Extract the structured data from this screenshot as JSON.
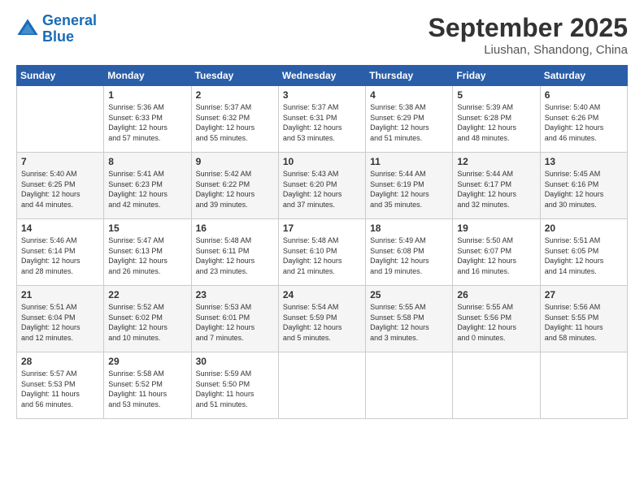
{
  "header": {
    "logo_line1": "General",
    "logo_line2": "Blue",
    "month": "September 2025",
    "location": "Liushan, Shandong, China"
  },
  "days": [
    "Sunday",
    "Monday",
    "Tuesday",
    "Wednesday",
    "Thursday",
    "Friday",
    "Saturday"
  ],
  "weeks": [
    [
      {
        "date": "",
        "sunrise": "",
        "sunset": "",
        "daylight": ""
      },
      {
        "date": "1",
        "sunrise": "Sunrise: 5:36 AM",
        "sunset": "Sunset: 6:33 PM",
        "daylight": "Daylight: 12 hours and 57 minutes."
      },
      {
        "date": "2",
        "sunrise": "Sunrise: 5:37 AM",
        "sunset": "Sunset: 6:32 PM",
        "daylight": "Daylight: 12 hours and 55 minutes."
      },
      {
        "date": "3",
        "sunrise": "Sunrise: 5:37 AM",
        "sunset": "Sunset: 6:31 PM",
        "daylight": "Daylight: 12 hours and 53 minutes."
      },
      {
        "date": "4",
        "sunrise": "Sunrise: 5:38 AM",
        "sunset": "Sunset: 6:29 PM",
        "daylight": "Daylight: 12 hours and 51 minutes."
      },
      {
        "date": "5",
        "sunrise": "Sunrise: 5:39 AM",
        "sunset": "Sunset: 6:28 PM",
        "daylight": "Daylight: 12 hours and 48 minutes."
      },
      {
        "date": "6",
        "sunrise": "Sunrise: 5:40 AM",
        "sunset": "Sunset: 6:26 PM",
        "daylight": "Daylight: 12 hours and 46 minutes."
      }
    ],
    [
      {
        "date": "7",
        "sunrise": "Sunrise: 5:40 AM",
        "sunset": "Sunset: 6:25 PM",
        "daylight": "Daylight: 12 hours and 44 minutes."
      },
      {
        "date": "8",
        "sunrise": "Sunrise: 5:41 AM",
        "sunset": "Sunset: 6:23 PM",
        "daylight": "Daylight: 12 hours and 42 minutes."
      },
      {
        "date": "9",
        "sunrise": "Sunrise: 5:42 AM",
        "sunset": "Sunset: 6:22 PM",
        "daylight": "Daylight: 12 hours and 39 minutes."
      },
      {
        "date": "10",
        "sunrise": "Sunrise: 5:43 AM",
        "sunset": "Sunset: 6:20 PM",
        "daylight": "Daylight: 12 hours and 37 minutes."
      },
      {
        "date": "11",
        "sunrise": "Sunrise: 5:44 AM",
        "sunset": "Sunset: 6:19 PM",
        "daylight": "Daylight: 12 hours and 35 minutes."
      },
      {
        "date": "12",
        "sunrise": "Sunrise: 5:44 AM",
        "sunset": "Sunset: 6:17 PM",
        "daylight": "Daylight: 12 hours and 32 minutes."
      },
      {
        "date": "13",
        "sunrise": "Sunrise: 5:45 AM",
        "sunset": "Sunset: 6:16 PM",
        "daylight": "Daylight: 12 hours and 30 minutes."
      }
    ],
    [
      {
        "date": "14",
        "sunrise": "Sunrise: 5:46 AM",
        "sunset": "Sunset: 6:14 PM",
        "daylight": "Daylight: 12 hours and 28 minutes."
      },
      {
        "date": "15",
        "sunrise": "Sunrise: 5:47 AM",
        "sunset": "Sunset: 6:13 PM",
        "daylight": "Daylight: 12 hours and 26 minutes."
      },
      {
        "date": "16",
        "sunrise": "Sunrise: 5:48 AM",
        "sunset": "Sunset: 6:11 PM",
        "daylight": "Daylight: 12 hours and 23 minutes."
      },
      {
        "date": "17",
        "sunrise": "Sunrise: 5:48 AM",
        "sunset": "Sunset: 6:10 PM",
        "daylight": "Daylight: 12 hours and 21 minutes."
      },
      {
        "date": "18",
        "sunrise": "Sunrise: 5:49 AM",
        "sunset": "Sunset: 6:08 PM",
        "daylight": "Daylight: 12 hours and 19 minutes."
      },
      {
        "date": "19",
        "sunrise": "Sunrise: 5:50 AM",
        "sunset": "Sunset: 6:07 PM",
        "daylight": "Daylight: 12 hours and 16 minutes."
      },
      {
        "date": "20",
        "sunrise": "Sunrise: 5:51 AM",
        "sunset": "Sunset: 6:05 PM",
        "daylight": "Daylight: 12 hours and 14 minutes."
      }
    ],
    [
      {
        "date": "21",
        "sunrise": "Sunrise: 5:51 AM",
        "sunset": "Sunset: 6:04 PM",
        "daylight": "Daylight: 12 hours and 12 minutes."
      },
      {
        "date": "22",
        "sunrise": "Sunrise: 5:52 AM",
        "sunset": "Sunset: 6:02 PM",
        "daylight": "Daylight: 12 hours and 10 minutes."
      },
      {
        "date": "23",
        "sunrise": "Sunrise: 5:53 AM",
        "sunset": "Sunset: 6:01 PM",
        "daylight": "Daylight: 12 hours and 7 minutes."
      },
      {
        "date": "24",
        "sunrise": "Sunrise: 5:54 AM",
        "sunset": "Sunset: 5:59 PM",
        "daylight": "Daylight: 12 hours and 5 minutes."
      },
      {
        "date": "25",
        "sunrise": "Sunrise: 5:55 AM",
        "sunset": "Sunset: 5:58 PM",
        "daylight": "Daylight: 12 hours and 3 minutes."
      },
      {
        "date": "26",
        "sunrise": "Sunrise: 5:55 AM",
        "sunset": "Sunset: 5:56 PM",
        "daylight": "Daylight: 12 hours and 0 minutes."
      },
      {
        "date": "27",
        "sunrise": "Sunrise: 5:56 AM",
        "sunset": "Sunset: 5:55 PM",
        "daylight": "Daylight: 11 hours and 58 minutes."
      }
    ],
    [
      {
        "date": "28",
        "sunrise": "Sunrise: 5:57 AM",
        "sunset": "Sunset: 5:53 PM",
        "daylight": "Daylight: 11 hours and 56 minutes."
      },
      {
        "date": "29",
        "sunrise": "Sunrise: 5:58 AM",
        "sunset": "Sunset: 5:52 PM",
        "daylight": "Daylight: 11 hours and 53 minutes."
      },
      {
        "date": "30",
        "sunrise": "Sunrise: 5:59 AM",
        "sunset": "Sunset: 5:50 PM",
        "daylight": "Daylight: 11 hours and 51 minutes."
      },
      {
        "date": "",
        "sunrise": "",
        "sunset": "",
        "daylight": ""
      },
      {
        "date": "",
        "sunrise": "",
        "sunset": "",
        "daylight": ""
      },
      {
        "date": "",
        "sunrise": "",
        "sunset": "",
        "daylight": ""
      },
      {
        "date": "",
        "sunrise": "",
        "sunset": "",
        "daylight": ""
      }
    ]
  ]
}
